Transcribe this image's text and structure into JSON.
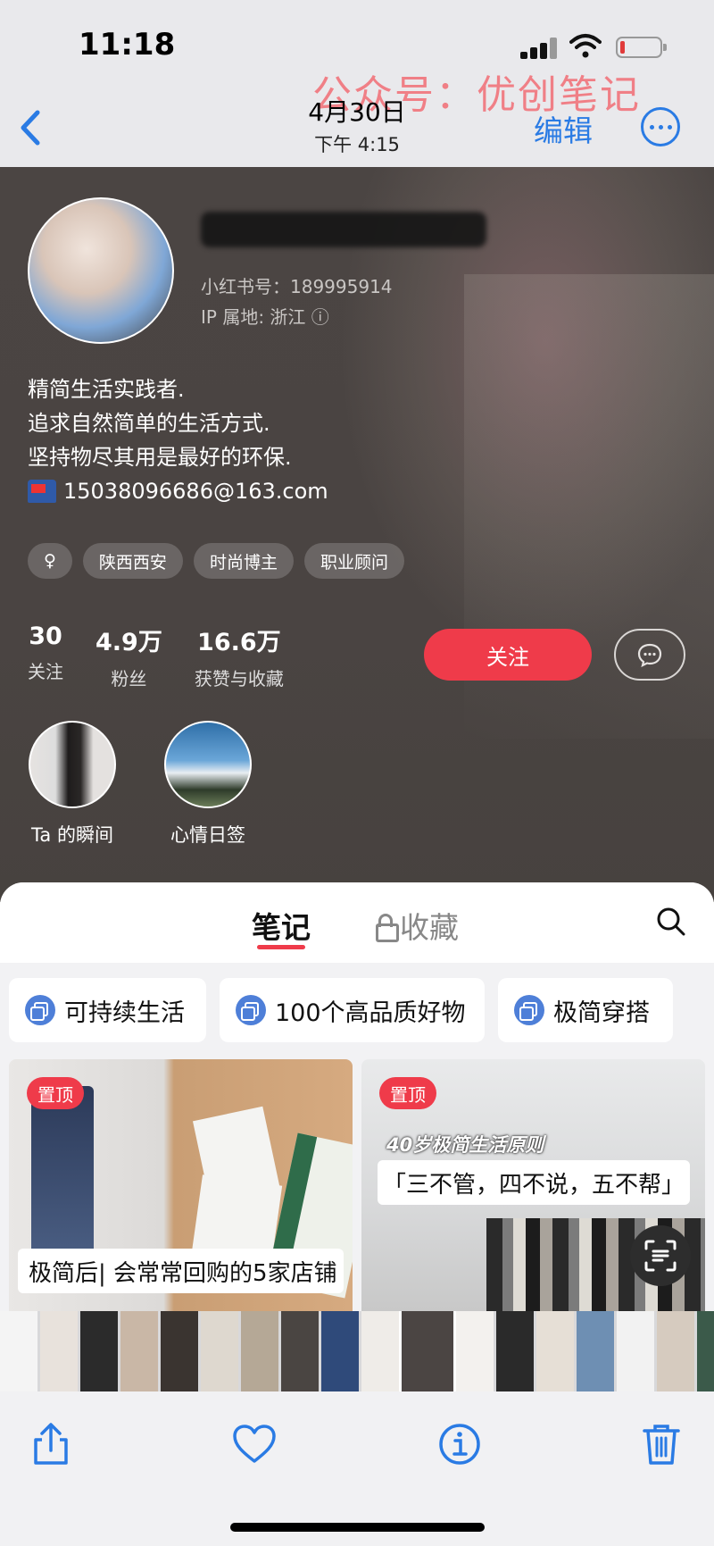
{
  "status_bar": {
    "time": "11:18"
  },
  "nav": {
    "date": "4月30日",
    "time": "下午 4:15",
    "edit_label": "编辑",
    "watermark": "公众号：优创笔记"
  },
  "profile": {
    "rednote_id": "小红书号：189995914",
    "ip_location": "IP 属地: 浙江  ⓘ",
    "bio": [
      "精简生活实践者.",
      "追求自然简单的生活方式.",
      "坚持物尽其用是最好的环保."
    ],
    "email": "15038096686@163.com",
    "tags": [
      "♀",
      "陕西西安",
      "时尚博主",
      "职业顾问"
    ],
    "stats": [
      {
        "value": "30",
        "label": "关注"
      },
      {
        "value": "4.9万",
        "label": "粉丝"
      },
      {
        "value": "16.6万",
        "label": "获赞与收藏"
      }
    ],
    "follow_label": "关注",
    "moments": [
      {
        "label": "Ta 的瞬间"
      },
      {
        "label": "心情日签"
      }
    ]
  },
  "tabs": {
    "notes": "笔记",
    "favorites": "收藏"
  },
  "collections": [
    "可持续生活",
    "100个高品质好物",
    "极简穿搭"
  ],
  "cards": [
    {
      "pin": "置顶",
      "title": "极简后| 会常常回购的5家店铺"
    },
    {
      "pin": "置顶",
      "subtitle": "40岁极简生活原则",
      "title": "「三不管，四不说，五不帮」"
    }
  ],
  "colors": {
    "accent": "#ef3b4a",
    "ios_blue": "#2a7be4",
    "watermark": "#f07f86"
  },
  "icons": [
    "back-chevron-icon",
    "more-icon",
    "search-icon",
    "lock-icon",
    "chat-icon",
    "share-icon",
    "heart-icon",
    "info-icon",
    "trash-icon",
    "scan-text-icon"
  ]
}
